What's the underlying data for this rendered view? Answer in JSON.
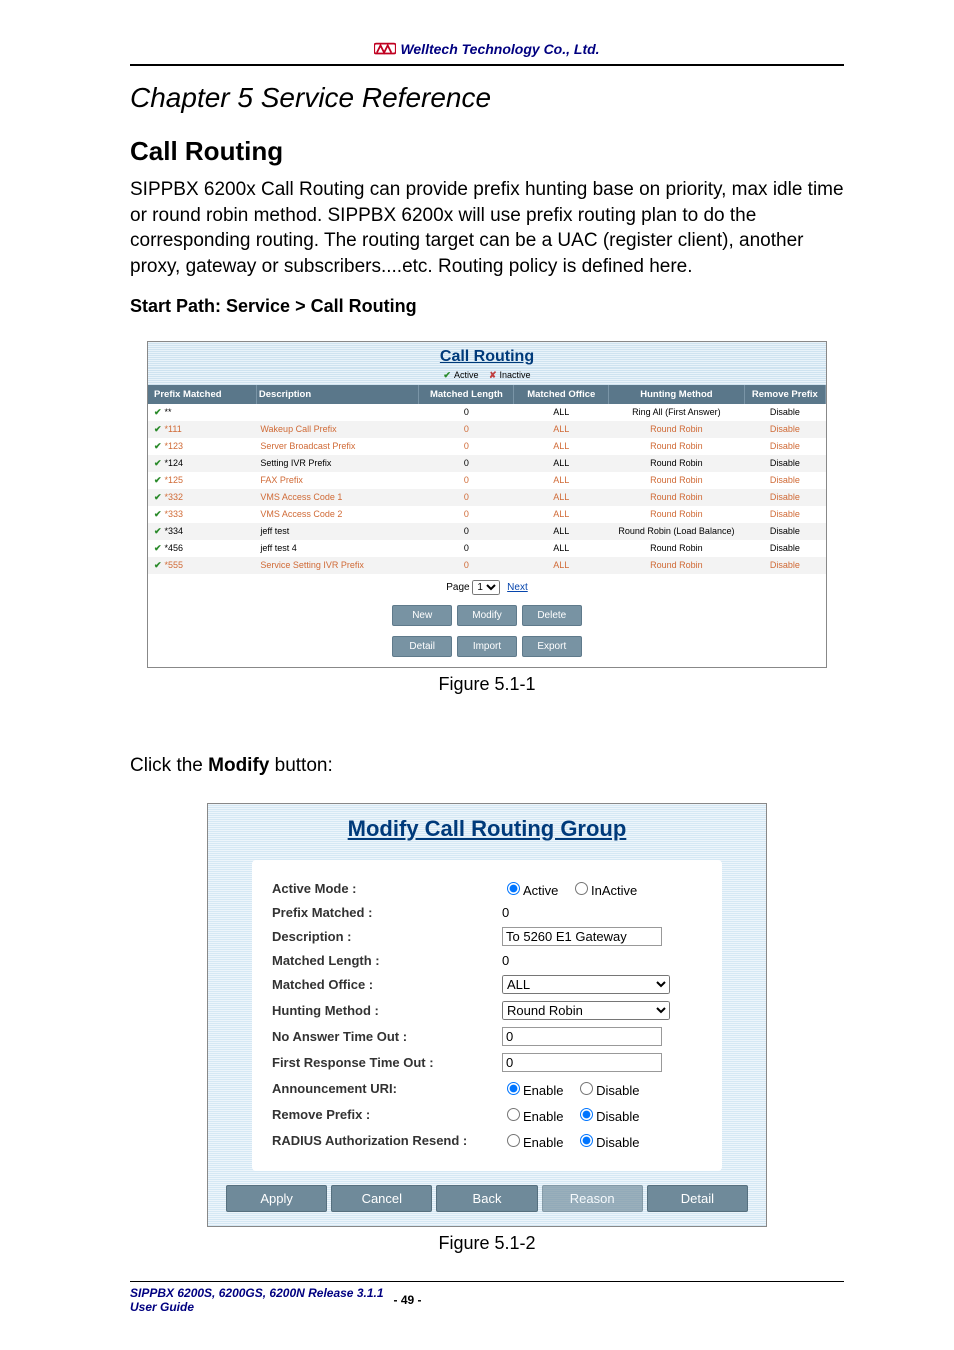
{
  "header": {
    "company": "Welltech Technology Co., Ltd."
  },
  "doc": {
    "chapter": "Chapter 5 Service Reference",
    "section": "Call Routing",
    "intro": "SIPPBX 6200x Call Routing can provide prefix hunting base on priority, max idle time or round robin method. SIPPBX 6200x will use prefix routing plan to do the corresponding routing. The routing target can be a UAC (register client), another proxy, gateway or subscribers....etc. Routing policy is defined here.",
    "start_path": "Start Path: Service > Call Routing",
    "click_pre": "Click the ",
    "click_bold": "Modify",
    "click_post": " button:"
  },
  "fig1": {
    "title": "Call Routing",
    "legend": {
      "active": "Active",
      "inactive": "Inactive"
    },
    "cols": [
      "Prefix Matched",
      "Description",
      "Matched Length",
      "Matched Office",
      "Hunting Method",
      "Remove Prefix"
    ],
    "rows": [
      {
        "active": true,
        "inactive": false,
        "prefix": "**",
        "desc": "",
        "len": "0",
        "office": "ALL",
        "hunt": "Ring All (First Answer)",
        "remove": "Disable"
      },
      {
        "active": true,
        "inactive": true,
        "prefix": "*111",
        "desc": "Wakeup Call Prefix",
        "len": "0",
        "office": "ALL",
        "hunt": "Round Robin",
        "remove": "Disable"
      },
      {
        "active": true,
        "inactive": true,
        "prefix": "*123",
        "desc": "Server Broadcast Prefix",
        "len": "0",
        "office": "ALL",
        "hunt": "Round Robin",
        "remove": "Disable"
      },
      {
        "active": true,
        "inactive": false,
        "prefix": "*124",
        "desc": "Setting IVR Prefix",
        "len": "0",
        "office": "ALL",
        "hunt": "Round Robin",
        "remove": "Disable"
      },
      {
        "active": true,
        "inactive": true,
        "prefix": "*125",
        "desc": "FAX Prefix",
        "len": "0",
        "office": "ALL",
        "hunt": "Round Robin",
        "remove": "Disable"
      },
      {
        "active": true,
        "inactive": true,
        "prefix": "*332",
        "desc": "VMS Access Code 1",
        "len": "0",
        "office": "ALL",
        "hunt": "Round Robin",
        "remove": "Disable"
      },
      {
        "active": true,
        "inactive": true,
        "prefix": "*333",
        "desc": "VMS Access Code 2",
        "len": "0",
        "office": "ALL",
        "hunt": "Round Robin",
        "remove": "Disable"
      },
      {
        "active": true,
        "inactive": false,
        "prefix": "*334",
        "desc": "jeff test",
        "len": "0",
        "office": "ALL",
        "hunt": "Round Robin (Load Balance)",
        "remove": "Disable"
      },
      {
        "active": true,
        "inactive": false,
        "prefix": "*456",
        "desc": "jeff test 4",
        "len": "0",
        "office": "ALL",
        "hunt": "Round Robin",
        "remove": "Disable"
      },
      {
        "active": true,
        "inactive": true,
        "prefix": "*555",
        "desc": "Service Setting IVR Prefix",
        "len": "0",
        "office": "ALL",
        "hunt": "Round Robin",
        "remove": "Disable"
      }
    ],
    "pager": {
      "label": "Page",
      "current": "1",
      "next": "Next"
    },
    "buttons": [
      "New",
      "Modify",
      "Delete",
      "Detail",
      "Import",
      "Export"
    ],
    "caption": "Figure 5.1-1"
  },
  "fig2": {
    "title": "Modify Call Routing Group",
    "opts": {
      "enable": "Enable",
      "disable": "Disable"
    },
    "fields": {
      "active_mode": {
        "label": "Active Mode :",
        "opt1": "Active",
        "opt2": "InActive"
      },
      "prefix_matched": {
        "label": "Prefix Matched :",
        "value": "0"
      },
      "description": {
        "label": "Description :",
        "value": "To 5260 E1 Gateway"
      },
      "matched_length": {
        "label": "Matched Length :",
        "value": "0"
      },
      "matched_office": {
        "label": "Matched Office :",
        "value": "ALL"
      },
      "hunting_method": {
        "label": "Hunting Method :",
        "value": "Round Robin"
      },
      "no_answer": {
        "label": "No Answer Time Out :",
        "value": "0"
      },
      "first_response": {
        "label": "First Response Time Out :",
        "value": "0"
      },
      "announcement": {
        "label": "Announcement URI:",
        "value": "Enable"
      },
      "remove_prefix": {
        "label": "Remove Prefix :",
        "value": "Disable"
      },
      "radius_resend": {
        "label": "RADIUS Authorization Resend :",
        "value": "Disable"
      }
    },
    "buttons": [
      "Apply",
      "Cancel",
      "Back",
      "Reason",
      "Detail"
    ],
    "caption": "Figure 5.1-2"
  },
  "footer": {
    "line1": "SIPPBX 6200S, 6200GS, 6200N   Release 3.1.1",
    "line2": "User Guide",
    "page": "- 49 -"
  }
}
